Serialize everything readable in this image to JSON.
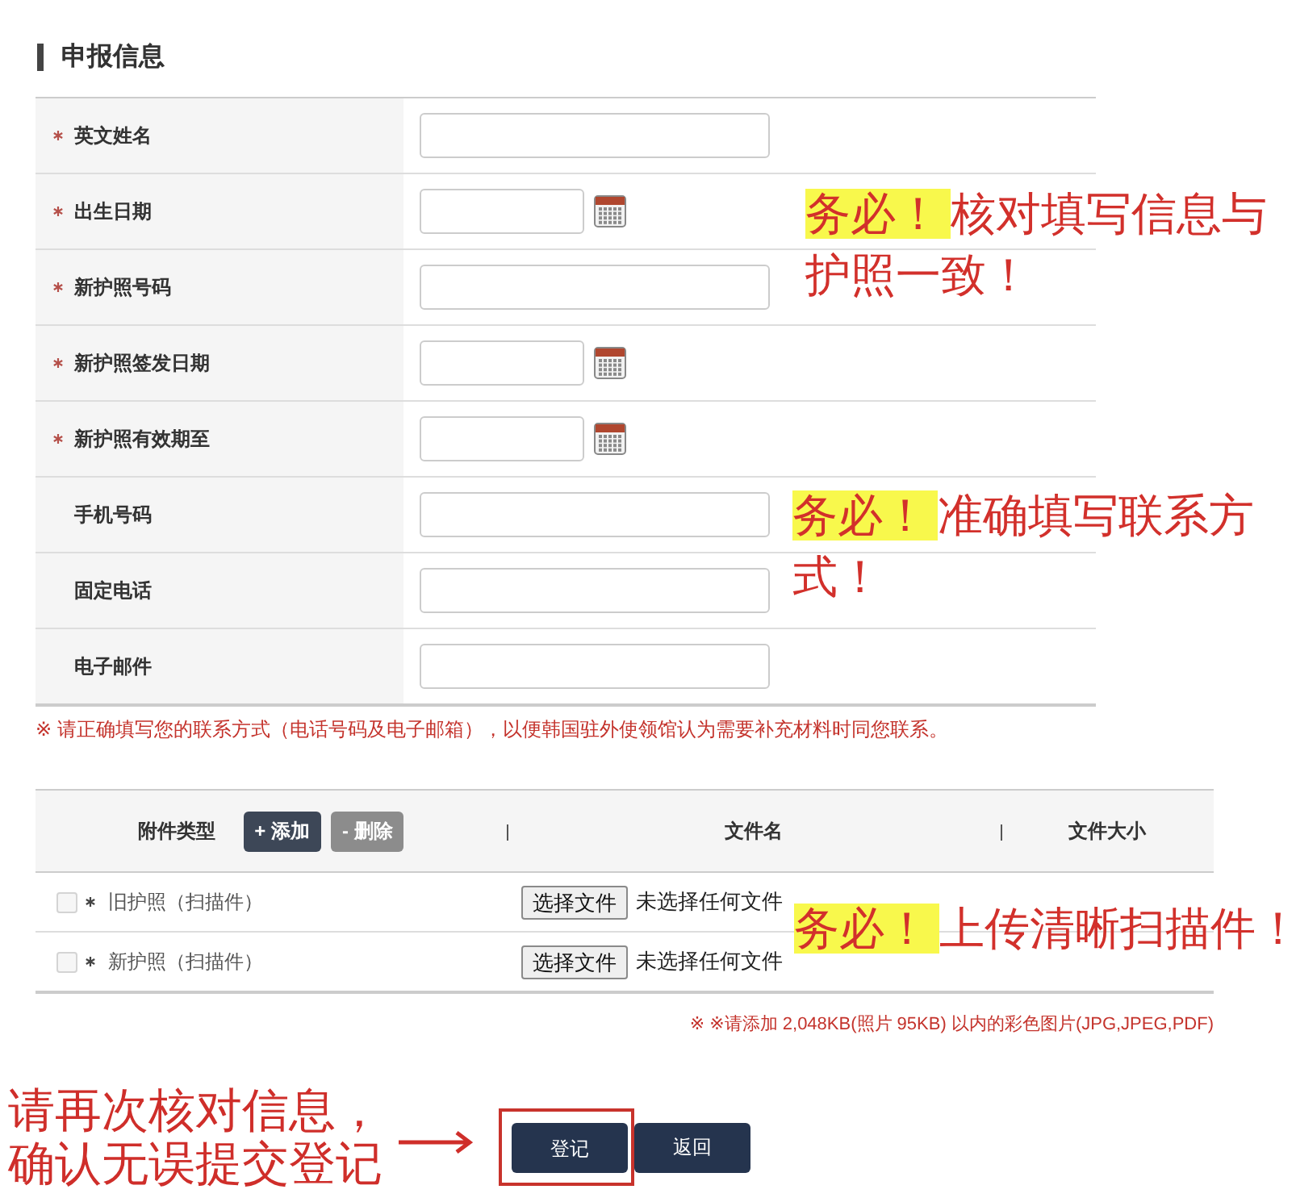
{
  "section_title": "申报信息",
  "fields": [
    {
      "label": "英文姓名",
      "required": true,
      "kind": "text"
    },
    {
      "label": "出生日期",
      "required": true,
      "kind": "date"
    },
    {
      "label": "新护照号码",
      "required": true,
      "kind": "text"
    },
    {
      "label": "新护照签发日期",
      "required": true,
      "kind": "date"
    },
    {
      "label": "新护照有效期至",
      "required": true,
      "kind": "date"
    },
    {
      "label": "手机号码",
      "required": false,
      "kind": "text"
    },
    {
      "label": "固定电话",
      "required": false,
      "kind": "text"
    },
    {
      "label": "电子邮件",
      "required": false,
      "kind": "text"
    }
  ],
  "contact_note": "※ 请正确填写您的联系方式（电话号码及电子邮箱），以便韩国驻外使领馆认为需要补充材料时同您联系。",
  "attachments": {
    "columns": [
      "附件类型",
      "文件名",
      "文件大小"
    ],
    "buttons": [
      {
        "label": "+ 添加",
        "kind": "add"
      },
      {
        "label": "- 删除",
        "kind": "delete"
      }
    ],
    "rows": [
      {
        "checked": false,
        "required": true,
        "type": "旧护照（扫描件）",
        "file_button": "选择文件",
        "file_status": "未选择任何文件"
      },
      {
        "checked": false,
        "required": true,
        "type": "新护照（扫描件）",
        "file_button": "选择文件",
        "file_status": "未选择任何文件"
      }
    ],
    "size_note": "※ ※请添加 2,048KB(照片 95KB) 以内的彩色图片(JPG,JPEG,PDF)"
  },
  "actions": [
    {
      "label": "登记",
      "highlighted": true
    },
    {
      "label": "返回",
      "highlighted": false
    }
  ],
  "annotations": [
    {
      "kind": "callout",
      "highlight": "务必！",
      "text": "核对填写信息与护照一致！"
    },
    {
      "kind": "callout",
      "highlight": "务必！",
      "text": "准确填写联系方式！"
    },
    {
      "kind": "callout",
      "highlight": "务必！",
      "text": "上传清晰扫描件！"
    },
    {
      "kind": "pointer",
      "text": "请再次核对信息，确认无误提交登记"
    }
  ]
}
